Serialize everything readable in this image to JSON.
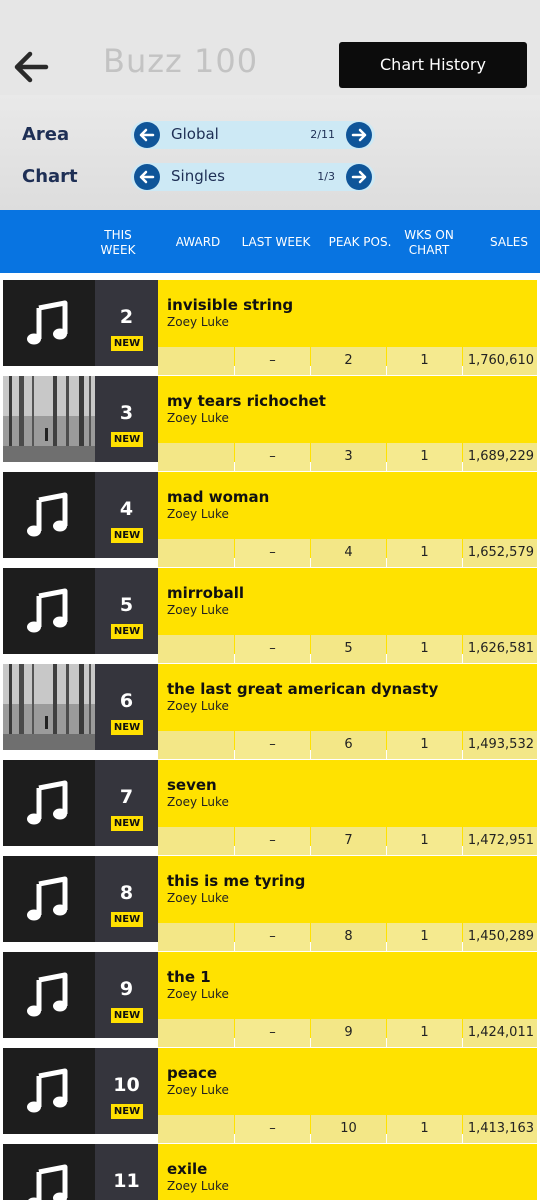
{
  "header": {
    "title": "Buzz 100",
    "history_label": "Chart History"
  },
  "filters": {
    "area": {
      "label": "Area",
      "value": "Global",
      "count": "2/11"
    },
    "chart": {
      "label": "Chart",
      "value": "Singles",
      "count": "1/3"
    }
  },
  "columns": {
    "this_week_1": "THIS",
    "this_week_2": "WEEK",
    "award": "AWARD",
    "last_week": "LAST WEEK",
    "peak": "PEAK POS.",
    "wks_1": "WKS ON",
    "wks_2": "CHART",
    "sales": "SALES"
  },
  "new_label": "NEW",
  "colors": {
    "accent_blue": "#0874e1",
    "row_yellow": "#ffe200",
    "badge_yellow": "#ffe000"
  },
  "rows": [
    {
      "rank": "2",
      "title": "invisible string",
      "artist": "Zoey Luke",
      "award": "",
      "last_week": "–",
      "peak": "2",
      "weeks": "1",
      "sales": "1,760,610",
      "art": "music-note-icon"
    },
    {
      "rank": "3",
      "title": "my tears richochet",
      "artist": "Zoey Luke",
      "award": "",
      "last_week": "–",
      "peak": "3",
      "weeks": "1",
      "sales": "1,689,229",
      "art": "album-cover-photo"
    },
    {
      "rank": "4",
      "title": "mad woman",
      "artist": "Zoey Luke",
      "award": "",
      "last_week": "–",
      "peak": "4",
      "weeks": "1",
      "sales": "1,652,579",
      "art": "music-note-icon"
    },
    {
      "rank": "5",
      "title": "mirroball",
      "artist": "Zoey Luke",
      "award": "",
      "last_week": "–",
      "peak": "5",
      "weeks": "1",
      "sales": "1,626,581",
      "art": "music-note-icon"
    },
    {
      "rank": "6",
      "title": "the last great american dynasty",
      "artist": "Zoey Luke",
      "award": "",
      "last_week": "–",
      "peak": "6",
      "weeks": "1",
      "sales": "1,493,532",
      "art": "album-cover-photo"
    },
    {
      "rank": "7",
      "title": "seven",
      "artist": "Zoey Luke",
      "award": "",
      "last_week": "–",
      "peak": "7",
      "weeks": "1",
      "sales": "1,472,951",
      "art": "music-note-icon"
    },
    {
      "rank": "8",
      "title": "this is me tyring",
      "artist": "Zoey Luke",
      "award": "",
      "last_week": "–",
      "peak": "8",
      "weeks": "1",
      "sales": "1,450,289",
      "art": "music-note-icon"
    },
    {
      "rank": "9",
      "title": "the 1",
      "artist": "Zoey Luke",
      "award": "",
      "last_week": "–",
      "peak": "9",
      "weeks": "1",
      "sales": "1,424,011",
      "art": "music-note-icon"
    },
    {
      "rank": "10",
      "title": "peace",
      "artist": "Zoey Luke",
      "award": "",
      "last_week": "–",
      "peak": "10",
      "weeks": "1",
      "sales": "1,413,163",
      "art": "music-note-icon"
    },
    {
      "rank": "11",
      "title": "exile",
      "artist": "Zoey Luke",
      "award": "",
      "last_week": "",
      "peak": "",
      "weeks": "",
      "sales": "",
      "art": "music-note-icon"
    }
  ]
}
